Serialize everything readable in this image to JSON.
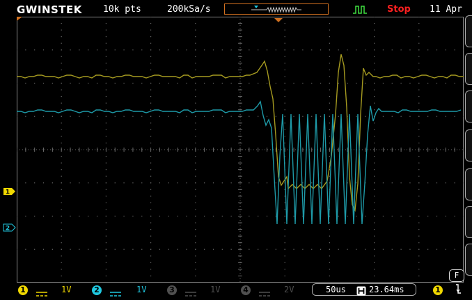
{
  "header": {
    "brand": "GWINSTEK",
    "record_length": "10k pts",
    "sample_rate": "200kSa/s",
    "run_status": "Stop",
    "date": "11 Apr"
  },
  "channels": [
    {
      "id": "1",
      "coupling_icon": "dc-coupling-icon",
      "scale": "1V",
      "color": "#f0d800",
      "active": true
    },
    {
      "id": "2",
      "coupling_icon": "dc-coupling-icon",
      "scale": "1V",
      "color": "#20c8e0",
      "active": true
    },
    {
      "id": "3",
      "coupling_icon": "dc-coupling-icon",
      "scale": "1V",
      "color": "#505050",
      "active": false
    },
    {
      "id": "4",
      "coupling_icon": "dc-coupling-icon",
      "scale": "2V",
      "color": "#505050",
      "active": false
    }
  ],
  "timebase": {
    "scale": "50us",
    "position_icon": "horizontal-position-icon",
    "position": "23.64ms"
  },
  "trigger": {
    "source": "1",
    "icon": "falling-edge-icon",
    "type_icon": "pulse-trigger-icon"
  },
  "function_badge": "F",
  "colors": {
    "ch1_trace": "#a59a20",
    "ch2_trace": "#1e9aa8",
    "grid": "#6a6a6a",
    "accent": "#d07020",
    "stop": "#ff2020"
  }
}
